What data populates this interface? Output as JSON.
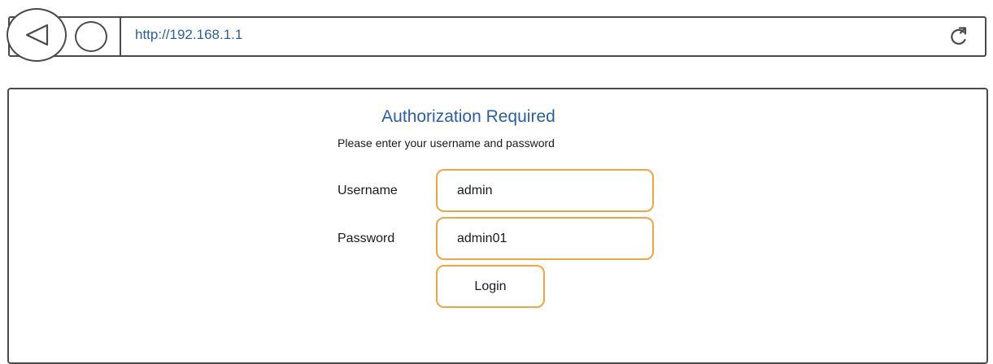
{
  "browser": {
    "url": "http://192.168.1.1",
    "icons": {
      "back": "back-arrow-icon",
      "home": "home-circle-icon",
      "refresh": "refresh-icon"
    }
  },
  "auth": {
    "title": "Authorization Required",
    "subtitle": "Please enter your username and password",
    "username_label": "Username",
    "username_value": "admin",
    "password_label": "Password",
    "password_value": "admin01",
    "login_label": "Login"
  },
  "colors": {
    "accent_border": "#f0a542",
    "link_blue": "#2a5fa8",
    "outline": "#4a4a4a"
  }
}
